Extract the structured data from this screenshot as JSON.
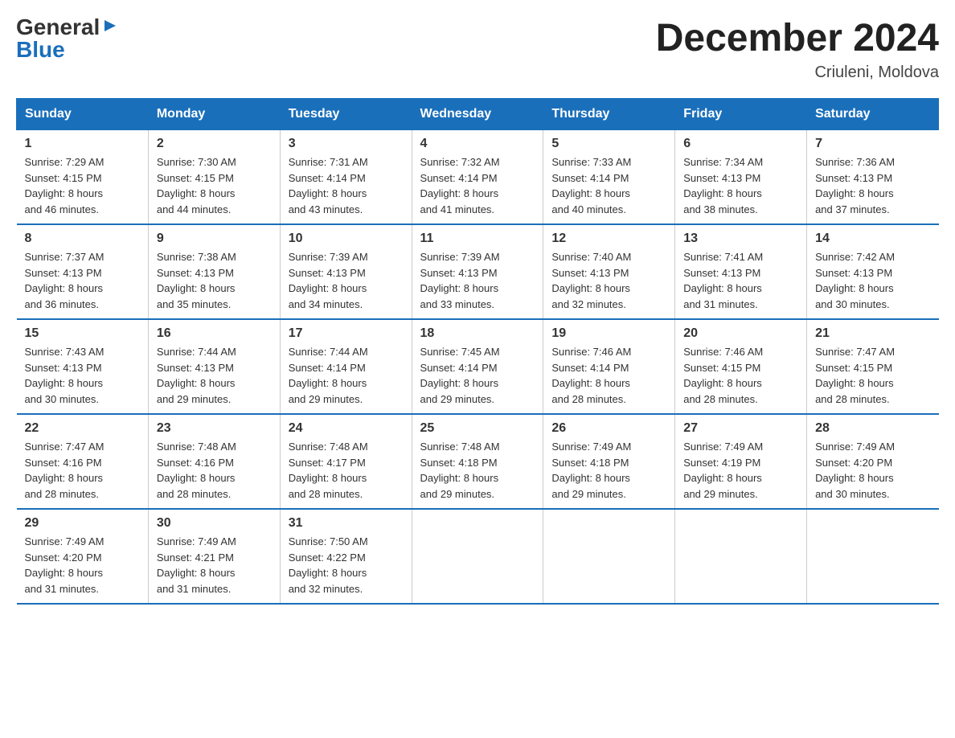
{
  "logo": {
    "general": "General",
    "blue": "Blue",
    "arrow": "▶"
  },
  "title": "December 2024",
  "location": "Criuleni, Moldova",
  "days_of_week": [
    "Sunday",
    "Monday",
    "Tuesday",
    "Wednesday",
    "Thursday",
    "Friday",
    "Saturday"
  ],
  "weeks": [
    [
      {
        "day": "1",
        "sunrise": "7:29 AM",
        "sunset": "4:15 PM",
        "daylight": "8 hours and 46 minutes."
      },
      {
        "day": "2",
        "sunrise": "7:30 AM",
        "sunset": "4:15 PM",
        "daylight": "8 hours and 44 minutes."
      },
      {
        "day": "3",
        "sunrise": "7:31 AM",
        "sunset": "4:14 PM",
        "daylight": "8 hours and 43 minutes."
      },
      {
        "day": "4",
        "sunrise": "7:32 AM",
        "sunset": "4:14 PM",
        "daylight": "8 hours and 41 minutes."
      },
      {
        "day": "5",
        "sunrise": "7:33 AM",
        "sunset": "4:14 PM",
        "daylight": "8 hours and 40 minutes."
      },
      {
        "day": "6",
        "sunrise": "7:34 AM",
        "sunset": "4:13 PM",
        "daylight": "8 hours and 38 minutes."
      },
      {
        "day": "7",
        "sunrise": "7:36 AM",
        "sunset": "4:13 PM",
        "daylight": "8 hours and 37 minutes."
      }
    ],
    [
      {
        "day": "8",
        "sunrise": "7:37 AM",
        "sunset": "4:13 PM",
        "daylight": "8 hours and 36 minutes."
      },
      {
        "day": "9",
        "sunrise": "7:38 AM",
        "sunset": "4:13 PM",
        "daylight": "8 hours and 35 minutes."
      },
      {
        "day": "10",
        "sunrise": "7:39 AM",
        "sunset": "4:13 PM",
        "daylight": "8 hours and 34 minutes."
      },
      {
        "day": "11",
        "sunrise": "7:39 AM",
        "sunset": "4:13 PM",
        "daylight": "8 hours and 33 minutes."
      },
      {
        "day": "12",
        "sunrise": "7:40 AM",
        "sunset": "4:13 PM",
        "daylight": "8 hours and 32 minutes."
      },
      {
        "day": "13",
        "sunrise": "7:41 AM",
        "sunset": "4:13 PM",
        "daylight": "8 hours and 31 minutes."
      },
      {
        "day": "14",
        "sunrise": "7:42 AM",
        "sunset": "4:13 PM",
        "daylight": "8 hours and 30 minutes."
      }
    ],
    [
      {
        "day": "15",
        "sunrise": "7:43 AM",
        "sunset": "4:13 PM",
        "daylight": "8 hours and 30 minutes."
      },
      {
        "day": "16",
        "sunrise": "7:44 AM",
        "sunset": "4:13 PM",
        "daylight": "8 hours and 29 minutes."
      },
      {
        "day": "17",
        "sunrise": "7:44 AM",
        "sunset": "4:14 PM",
        "daylight": "8 hours and 29 minutes."
      },
      {
        "day": "18",
        "sunrise": "7:45 AM",
        "sunset": "4:14 PM",
        "daylight": "8 hours and 29 minutes."
      },
      {
        "day": "19",
        "sunrise": "7:46 AM",
        "sunset": "4:14 PM",
        "daylight": "8 hours and 28 minutes."
      },
      {
        "day": "20",
        "sunrise": "7:46 AM",
        "sunset": "4:15 PM",
        "daylight": "8 hours and 28 minutes."
      },
      {
        "day": "21",
        "sunrise": "7:47 AM",
        "sunset": "4:15 PM",
        "daylight": "8 hours and 28 minutes."
      }
    ],
    [
      {
        "day": "22",
        "sunrise": "7:47 AM",
        "sunset": "4:16 PM",
        "daylight": "8 hours and 28 minutes."
      },
      {
        "day": "23",
        "sunrise": "7:48 AM",
        "sunset": "4:16 PM",
        "daylight": "8 hours and 28 minutes."
      },
      {
        "day": "24",
        "sunrise": "7:48 AM",
        "sunset": "4:17 PM",
        "daylight": "8 hours and 28 minutes."
      },
      {
        "day": "25",
        "sunrise": "7:48 AM",
        "sunset": "4:18 PM",
        "daylight": "8 hours and 29 minutes."
      },
      {
        "day": "26",
        "sunrise": "7:49 AM",
        "sunset": "4:18 PM",
        "daylight": "8 hours and 29 minutes."
      },
      {
        "day": "27",
        "sunrise": "7:49 AM",
        "sunset": "4:19 PM",
        "daylight": "8 hours and 29 minutes."
      },
      {
        "day": "28",
        "sunrise": "7:49 AM",
        "sunset": "4:20 PM",
        "daylight": "8 hours and 30 minutes."
      }
    ],
    [
      {
        "day": "29",
        "sunrise": "7:49 AM",
        "sunset": "4:20 PM",
        "daylight": "8 hours and 31 minutes."
      },
      {
        "day": "30",
        "sunrise": "7:49 AM",
        "sunset": "4:21 PM",
        "daylight": "8 hours and 31 minutes."
      },
      {
        "day": "31",
        "sunrise": "7:50 AM",
        "sunset": "4:22 PM",
        "daylight": "8 hours and 32 minutes."
      },
      null,
      null,
      null,
      null
    ]
  ],
  "labels": {
    "sunrise": "Sunrise:",
    "sunset": "Sunset:",
    "daylight": "Daylight:"
  }
}
